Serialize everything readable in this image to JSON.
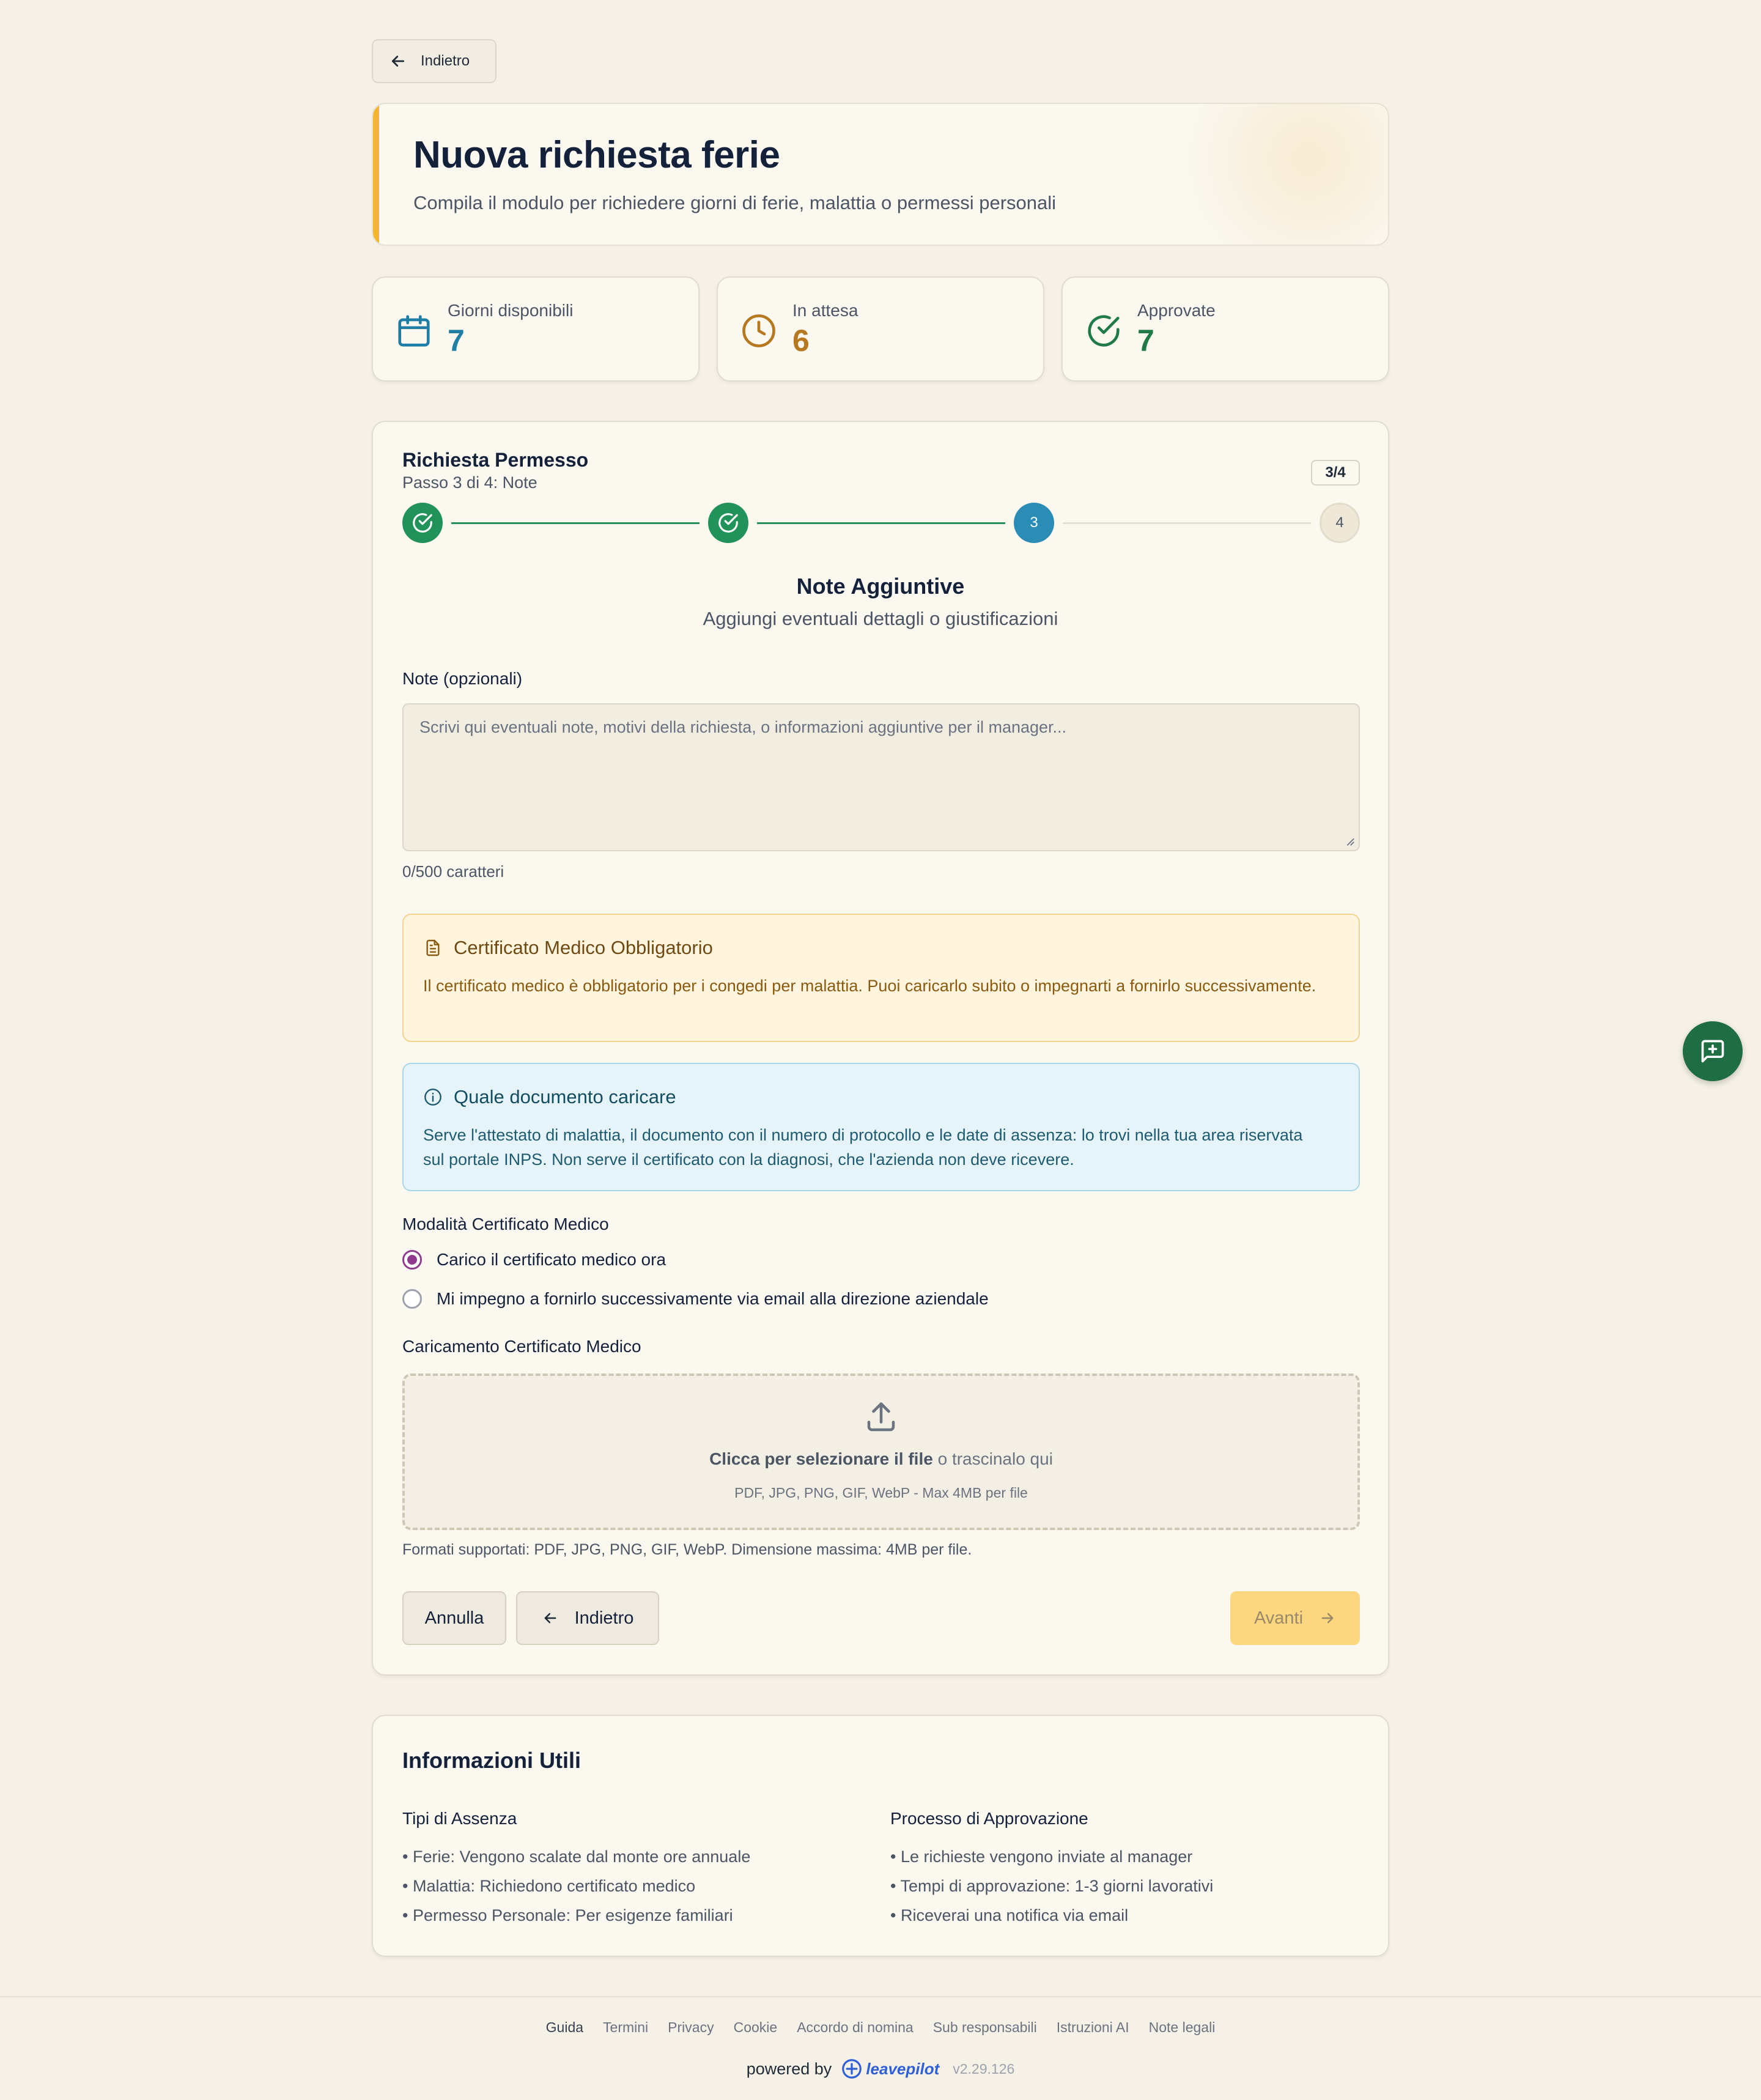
{
  "top": {
    "back_label": "Indietro"
  },
  "header": {
    "title": "Nuova richiesta ferie",
    "subtitle": "Compila il modulo per richiedere giorni di ferie, malattia o permessi personali",
    "accent_color": "#f5b52e"
  },
  "stats": [
    {
      "label": "Giorni disponibili",
      "value": "7",
      "icon": "calendar-icon",
      "color": "#1f7ea6"
    },
    {
      "label": "In attesa",
      "value": "6",
      "icon": "clock-icon",
      "color": "#b7791f"
    },
    {
      "label": "Approvate",
      "value": "7",
      "icon": "check-circle-icon",
      "color": "#1f7a45"
    }
  ],
  "form": {
    "title": "Richiesta Permesso",
    "step_text": "Passo 3 di 4: Note",
    "badge": "3/4",
    "steps": [
      {
        "state": "done"
      },
      {
        "state": "done"
      },
      {
        "state": "active",
        "label": "3"
      },
      {
        "state": "todo",
        "label": "4"
      }
    ],
    "section_title": "Note Aggiuntive",
    "section_subtitle": "Aggiungi eventuali dettagli o giustificazioni",
    "notes_label": "Note (opzionali)",
    "notes_placeholder": "Scrivi qui eventuali note, motivi della richiesta, o informazioni aggiuntive per il manager...",
    "notes_value": "",
    "counter": "0/500 caratteri",
    "warning": {
      "title": "Certificato Medico Obbligatorio",
      "body": "Il certificato medico è obbligatorio per i congedi per malattia. Puoi caricarlo subito o impegnarti a fornirlo successivamente."
    },
    "info": {
      "title": "Quale documento caricare",
      "body": "Serve l'attestato di malattia, il documento con il numero di protocollo e le date di assenza: lo trovi nella tua area riservata sul portale INPS. Non serve il certificato con la diagnosi, che l'azienda non deve ricevere."
    },
    "mode_label": "Modalità Certificato Medico",
    "options": [
      {
        "label": "Carico il certificato medico ora",
        "selected": true
      },
      {
        "label": "Mi impegno a fornirlo successivamente via email alla direzione aziendale",
        "selected": false
      }
    ],
    "upload_label": "Caricamento Certificato Medico",
    "upload_cta": "Clicca per selezionare il file",
    "upload_or": " o trascinalo qui",
    "upload_hint": "PDF, JPG, PNG, GIF, WebP - Max 4MB per file",
    "formats_note": "Formati supportati: PDF, JPG, PNG, GIF, WebP. Dimensione massima: 4MB per file.",
    "cancel_label": "Annulla",
    "back_label": "Indietro",
    "next_label": "Avanti"
  },
  "info_card": {
    "title": "Informazioni Utili",
    "col1_title": "Tipi di Assenza",
    "col1_items": [
      "• Ferie: Vengono scalate dal monte ore annuale",
      "• Malattia: Richiedono certificato medico",
      "• Permesso Personale: Per esigenze familiari"
    ],
    "col2_title": "Processo di Approvazione",
    "col2_items": [
      "• Le richieste vengono inviate al manager",
      "• Tempi di approvazione: 1-3 giorni lavorativi",
      "• Riceverai una notifica via email"
    ]
  },
  "footer": {
    "links": [
      "Guida",
      "Termini",
      "Privacy",
      "Cookie",
      "Accordo di nomina",
      "Sub responsabili",
      "Istruzioni AI",
      "Note legali"
    ],
    "powered_by": "powered by",
    "brand": "leavepilot",
    "version": "v2.29.126"
  }
}
